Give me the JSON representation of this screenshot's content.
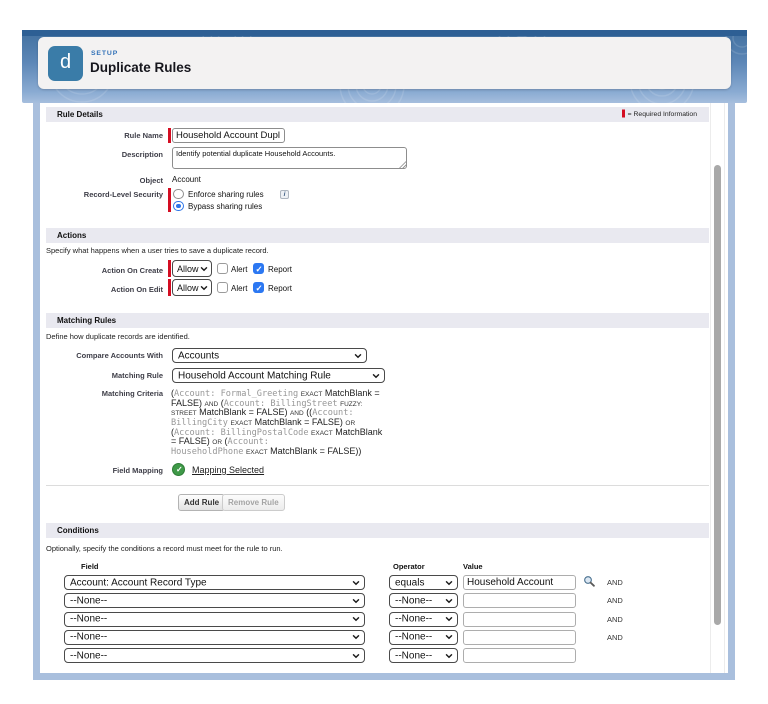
{
  "colors": {
    "banner_blue": "#41709f",
    "icon_blue": "#3a7ca8",
    "required_red": "#d40d22",
    "check_blue": "#2c78f2",
    "mapping_green": "#3f9948",
    "frame_blue": "#a9bfdd"
  },
  "header": {
    "setup_label": "SETUP",
    "title": "Duplicate Rules",
    "icon_letter": "d"
  },
  "rule_details": {
    "section_title": "Rule Details",
    "required_legend": "= Required Information",
    "rule_name": {
      "label": "Rule Name",
      "value": "Household Account Dupl"
    },
    "description": {
      "label": "Description",
      "value": "Identify potential duplicate Household Accounts."
    },
    "object": {
      "label": "Object",
      "value": "Account"
    },
    "record_level_security": {
      "label": "Record-Level Security",
      "options": [
        {
          "label": "Enforce sharing rules",
          "selected": false
        },
        {
          "label": "Bypass sharing rules",
          "selected": true
        }
      ]
    }
  },
  "actions": {
    "section_title": "Actions",
    "description": "Specify what happens when a user tries to save a duplicate record.",
    "rows": [
      {
        "label": "Action On Create",
        "select_value": "Allow",
        "alert_label": "Alert",
        "alert_checked": false,
        "report_label": "Report",
        "report_checked": true
      },
      {
        "label": "Action On Edit",
        "select_value": "Allow",
        "alert_label": "Alert",
        "alert_checked": false,
        "report_label": "Report",
        "report_checked": true
      }
    ]
  },
  "matching_rules": {
    "section_title": "Matching Rules",
    "description": "Define how duplicate records are identified.",
    "compare_with": {
      "label": "Compare Accounts With",
      "value": "Accounts"
    },
    "matching_rule": {
      "label": "Matching Rule",
      "value": "Household Account Matching Rule"
    },
    "matching_criteria": {
      "label": "Matching Criteria",
      "text": "(Account: Formal_Greeting EXACT MatchBlank = FALSE) AND (Account: BillingStreet FUZZY: STREET MatchBlank = FALSE) AND ((Account: BillingCity EXACT MatchBlank = FALSE) OR (Account: BillingPostalCode EXACT MatchBlank = FALSE) OR (Account: HouseholdPhone EXACT MatchBlank = FALSE))",
      "lines": [
        [
          {
            "t": "(",
            "s": "p"
          },
          {
            "t": "Account: Formal_Greeting",
            "s": "m"
          },
          {
            "t": " ",
            "s": "p"
          },
          {
            "t": "EXACT",
            "s": "k"
          },
          {
            "t": " MatchBlank =",
            "s": "p"
          }
        ],
        [
          {
            "t": "FALSE) ",
            "s": "p"
          },
          {
            "t": "AND",
            "s": "k"
          },
          {
            "t": " (",
            "s": "p"
          },
          {
            "t": "Account: BillingStreet",
            "s": "m"
          },
          {
            "t": " ",
            "s": "p"
          },
          {
            "t": "FUZZY:",
            "s": "k"
          }
        ],
        [
          {
            "t": "STREET",
            "s": "k"
          },
          {
            "t": " MatchBlank = FALSE) ",
            "s": "p"
          },
          {
            "t": "AND",
            "s": "k"
          },
          {
            "t": " ((",
            "s": "p"
          },
          {
            "t": "Account:",
            "s": "m"
          }
        ],
        [
          {
            "t": "BillingCity",
            "s": "m"
          },
          {
            "t": " ",
            "s": "p"
          },
          {
            "t": "EXACT",
            "s": "k"
          },
          {
            "t": " MatchBlank = FALSE) ",
            "s": "p"
          },
          {
            "t": "OR",
            "s": "k"
          }
        ],
        [
          {
            "t": "(",
            "s": "p"
          },
          {
            "t": "Account: BillingPostalCode",
            "s": "m"
          },
          {
            "t": " ",
            "s": "p"
          },
          {
            "t": "EXACT",
            "s": "k"
          },
          {
            "t": " MatchBlank",
            "s": "p"
          }
        ],
        [
          {
            "t": "= FALSE) ",
            "s": "p"
          },
          {
            "t": "OR",
            "s": "k"
          },
          {
            "t": " (",
            "s": "p"
          },
          {
            "t": "Account:",
            "s": "m"
          }
        ],
        [
          {
            "t": "HouseholdPhone",
            "s": "m"
          },
          {
            "t": " ",
            "s": "p"
          },
          {
            "t": "EXACT",
            "s": "k"
          },
          {
            "t": " MatchBlank = FALSE))",
            "s": "p"
          }
        ]
      ]
    },
    "field_mapping": {
      "label": "Field Mapping",
      "link": "Mapping Selected"
    },
    "buttons": {
      "add": "Add Rule",
      "remove": "Remove Rule"
    }
  },
  "conditions": {
    "section_title": "Conditions",
    "description": "Optionally, specify the conditions a record must meet for the rule to run.",
    "columns": [
      "Field",
      "Operator",
      "Value"
    ],
    "rows": [
      {
        "field": "Account: Account Record Type",
        "operator": "equals",
        "value": "Household Account",
        "has_lookup": true,
        "connector": "AND"
      },
      {
        "field": "--None--",
        "operator": "--None--",
        "value": "",
        "has_lookup": false,
        "connector": "AND"
      },
      {
        "field": "--None--",
        "operator": "--None--",
        "value": "",
        "has_lookup": false,
        "connector": "AND"
      },
      {
        "field": "--None--",
        "operator": "--None--",
        "value": "",
        "has_lookup": false,
        "connector": "AND"
      },
      {
        "field": "--None--",
        "operator": "--None--",
        "value": "",
        "has_lookup": false,
        "connector": ""
      }
    ]
  }
}
